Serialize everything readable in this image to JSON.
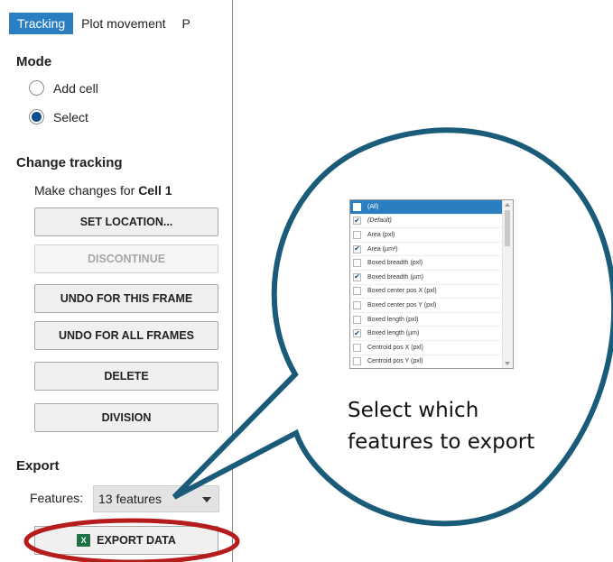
{
  "tabs": [
    {
      "label": "Tracking",
      "active": true
    },
    {
      "label": "Plot movement",
      "active": false
    },
    {
      "label": "P",
      "active": false
    }
  ],
  "mode": {
    "title": "Mode",
    "options": [
      {
        "label": "Add cell",
        "checked": false
      },
      {
        "label": "Select",
        "checked": true
      }
    ]
  },
  "change_tracking": {
    "title": "Change tracking",
    "caption_prefix": "Make changes for",
    "caption_target": "Cell 1",
    "buttons": {
      "set_location": "SET LOCATION...",
      "discontinue": "DISCONTINUE",
      "undo_frame": "UNDO FOR THIS FRAME",
      "undo_all": "UNDO FOR ALL FRAMES",
      "delete": "DELETE",
      "division": "DIVISION"
    }
  },
  "export": {
    "title": "Export",
    "features_label": "Features:",
    "features_value": "13 features",
    "export_button": "EXPORT DATA",
    "export_icon": "excel-icon"
  },
  "callout": {
    "text_line1": "Select which",
    "text_line2": "features to export",
    "border_color": "#1b5b7a",
    "highlight_color": "#b71c1c",
    "features_list": [
      {
        "label": "(All)",
        "checked": false,
        "highlighted": true
      },
      {
        "label": "(Default)",
        "checked": true,
        "highlighted": false
      },
      {
        "label": "Area (pxl)",
        "checked": false,
        "highlighted": false
      },
      {
        "label": "Area (µm²)",
        "checked": true,
        "highlighted": false
      },
      {
        "label": "Boxed breadth (pxl)",
        "checked": false,
        "highlighted": false
      },
      {
        "label": "Boxed breadth (µm)",
        "checked": true,
        "highlighted": false
      },
      {
        "label": "Boxed center pos X (pxl)",
        "checked": false,
        "highlighted": false
      },
      {
        "label": "Boxed center pos Y (pxl)",
        "checked": false,
        "highlighted": false
      },
      {
        "label": "Boxed length (pxl)",
        "checked": false,
        "highlighted": false
      },
      {
        "label": "Boxed length (µm)",
        "checked": true,
        "highlighted": false
      },
      {
        "label": "Centroid pos X (pxl)",
        "checked": false,
        "highlighted": false
      },
      {
        "label": "Centroid pos Y (pxl)",
        "checked": false,
        "highlighted": false
      }
    ]
  },
  "colors": {
    "accent": "#2b7fc1",
    "radio_fill": "#0b4f8a",
    "excel_green": "#1e7145"
  }
}
